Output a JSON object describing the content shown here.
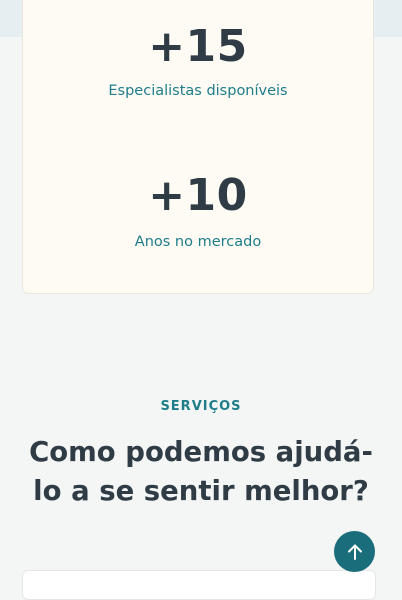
{
  "stats": [
    {
      "value": "+15",
      "label": "Especialistas disponíveis"
    },
    {
      "value": "+10",
      "label": "Anos no mercado"
    }
  ],
  "services": {
    "eyebrow": "SERVIÇOS",
    "title": "Como podemos ajudá-lo a se sentir melhor?"
  },
  "back_to_top": {
    "icon": "arrow-up-icon"
  },
  "colors": {
    "accent": "#1f7d8a",
    "heading": "#2f3b45",
    "button": "#1a6d7b",
    "card_bg": "#fdfbf3"
  }
}
